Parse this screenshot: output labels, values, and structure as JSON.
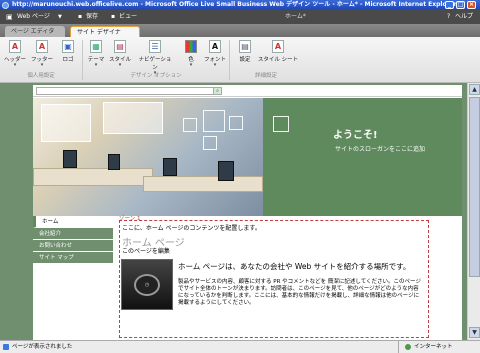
{
  "window": {
    "title": "http://marunouchi.web.officelive.com - Microsoft Office Live Small Business Web デザイン ツール - ホーム* - Microsoft Internet Explorer"
  },
  "menubar": {
    "webpage": "Web ページ",
    "save": "保存",
    "view": "ビュー",
    "breadcrumb": "ホーム*",
    "help": "ヘルプ"
  },
  "tabs": [
    {
      "label": "ページ エディタ"
    },
    {
      "label": "サイト デザイナ"
    }
  ],
  "ribbon": {
    "buttons": [
      {
        "label": "ヘッダー",
        "icon": "header-icon"
      },
      {
        "label": "フッター",
        "icon": "footer-icon"
      },
      {
        "label": "ロゴ",
        "icon": "logo-icon"
      },
      {
        "label": "テーマ",
        "icon": "theme-icon"
      },
      {
        "label": "スタイル",
        "icon": "style-icon"
      },
      {
        "label": "ナビゲーション",
        "icon": "navigation-icon"
      },
      {
        "label": "色",
        "icon": "color-icon"
      },
      {
        "label": "フォント",
        "icon": "font-icon"
      },
      {
        "label": "設定",
        "icon": "settings-icon"
      },
      {
        "label": "スタイル シート",
        "icon": "stylesheet-icon"
      }
    ],
    "groups": [
      "個人用設定",
      "デザイン オプション",
      "詳細設定"
    ]
  },
  "site": {
    "welcome": "ようこそ!",
    "slogan": "サイトのスローガンをここに追加",
    "nav": [
      "ホーム",
      "会社紹介",
      "お問い合わせ",
      "サイト マップ"
    ],
    "zone_label": "ゾーン 1",
    "content_hint": "ここに、ホーム ページのコンテンツを配置します。",
    "page_heading": "ホーム ページ",
    "edit_link": "このページを編集",
    "headline": "ホーム ページは、あなたの会社や Web サイトを紹介する場所です。",
    "body": "製品やサービスの内容、顧客に対する PR やコメントなどを 簡潔に記述してください。このページでサイト全体のトーンが決まります。訪問者は、このページを見て、他のページがどのような内容になっているかを判断します。ここには、基本的な情報だけを掲載し、詳細な情報は他のページに掲載するようにしてください。"
  },
  "status": {
    "text": "ページが表示されました",
    "zone": "インターネット"
  },
  "colors": {
    "accent_green": "#5e8a5e",
    "titlebar_blue": "#1c45b8"
  }
}
